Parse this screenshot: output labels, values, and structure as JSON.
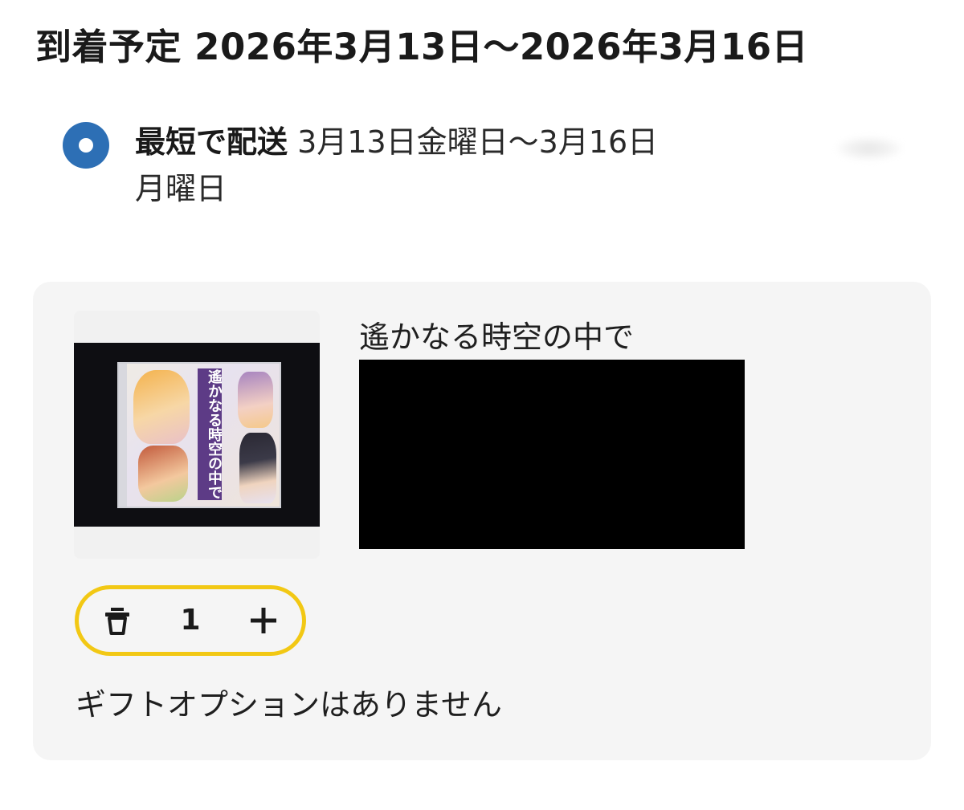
{
  "delivery": {
    "heading": "到着予定 2026年3月13日〜2026年3月16日",
    "option": {
      "label": "最短で配送",
      "dates_line1": " 3月13日金曜日〜3月16日",
      "dates_line2": "月曜日",
      "selected": true
    }
  },
  "item": {
    "title": "遙かなる時空の中で",
    "quantity": "1",
    "gift_note": "ギフトオプションはありません"
  },
  "icons": {
    "radio": "radio-selected-icon",
    "trash": "trash-icon",
    "plus": "plus-icon"
  },
  "colors": {
    "radio": "#2d6fb5",
    "stepper_border": "#f2c814",
    "card_background": "#f5f5f5",
    "redaction": "#000000"
  }
}
